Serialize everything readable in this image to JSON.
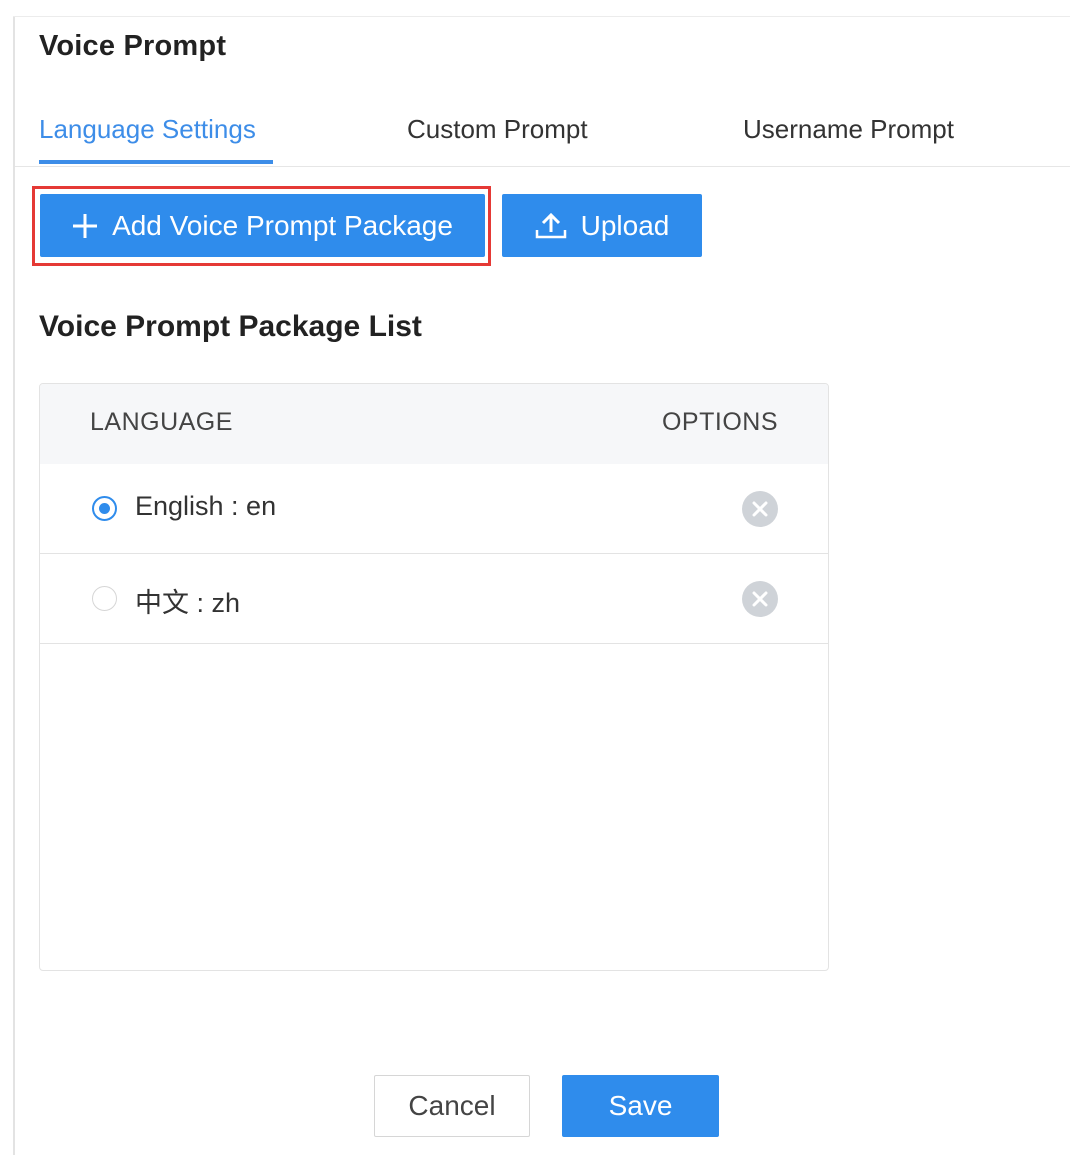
{
  "page": {
    "title": "Voice Prompt"
  },
  "tabs": [
    {
      "label": "Language Settings",
      "active": true
    },
    {
      "label": "Custom Prompt",
      "active": false
    },
    {
      "label": "Username Prompt",
      "active": false
    }
  ],
  "toolbar": {
    "add_label": "Add Voice Prompt Package",
    "add_icon": "plus-icon",
    "upload_label": "Upload",
    "upload_icon": "upload-icon",
    "highlighted": "add_button"
  },
  "list": {
    "title": "Voice Prompt Package List",
    "columns": [
      "LANGUAGE",
      "OPTIONS"
    ],
    "rows": [
      {
        "label": "English : en",
        "selected": true,
        "option_icon": "delete-icon"
      },
      {
        "label": "中文 : zh",
        "selected": false,
        "option_icon": "delete-icon"
      }
    ]
  },
  "footer": {
    "cancel_label": "Cancel",
    "save_label": "Save"
  },
  "colors": {
    "accent": "#2f8cec",
    "tab_active": "#3d8de8",
    "highlight": "#e53935",
    "icon_gray": "#cfd3d8"
  }
}
